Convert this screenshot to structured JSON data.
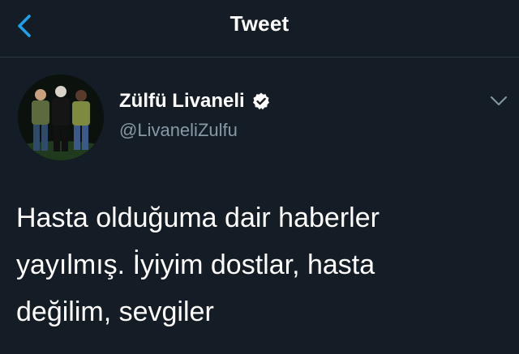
{
  "header": {
    "title": "Tweet",
    "back_icon": "chevron-left-icon",
    "accent_color": "#1da1f2"
  },
  "tweet": {
    "author": {
      "name": "Zülfü Livaneli",
      "handle": "@LivaneliZulfu",
      "verified": true,
      "verified_icon": "verified-badge-icon"
    },
    "menu_icon": "chevron-down-icon",
    "text": "Hasta olduğuma dair haberler\nyayılmış.  İyiyim dostlar, hasta\ndeğilim, sevgiler"
  },
  "colors": {
    "background": "#141d26",
    "divider": "#2b3640",
    "secondary_text": "#8899a6"
  }
}
